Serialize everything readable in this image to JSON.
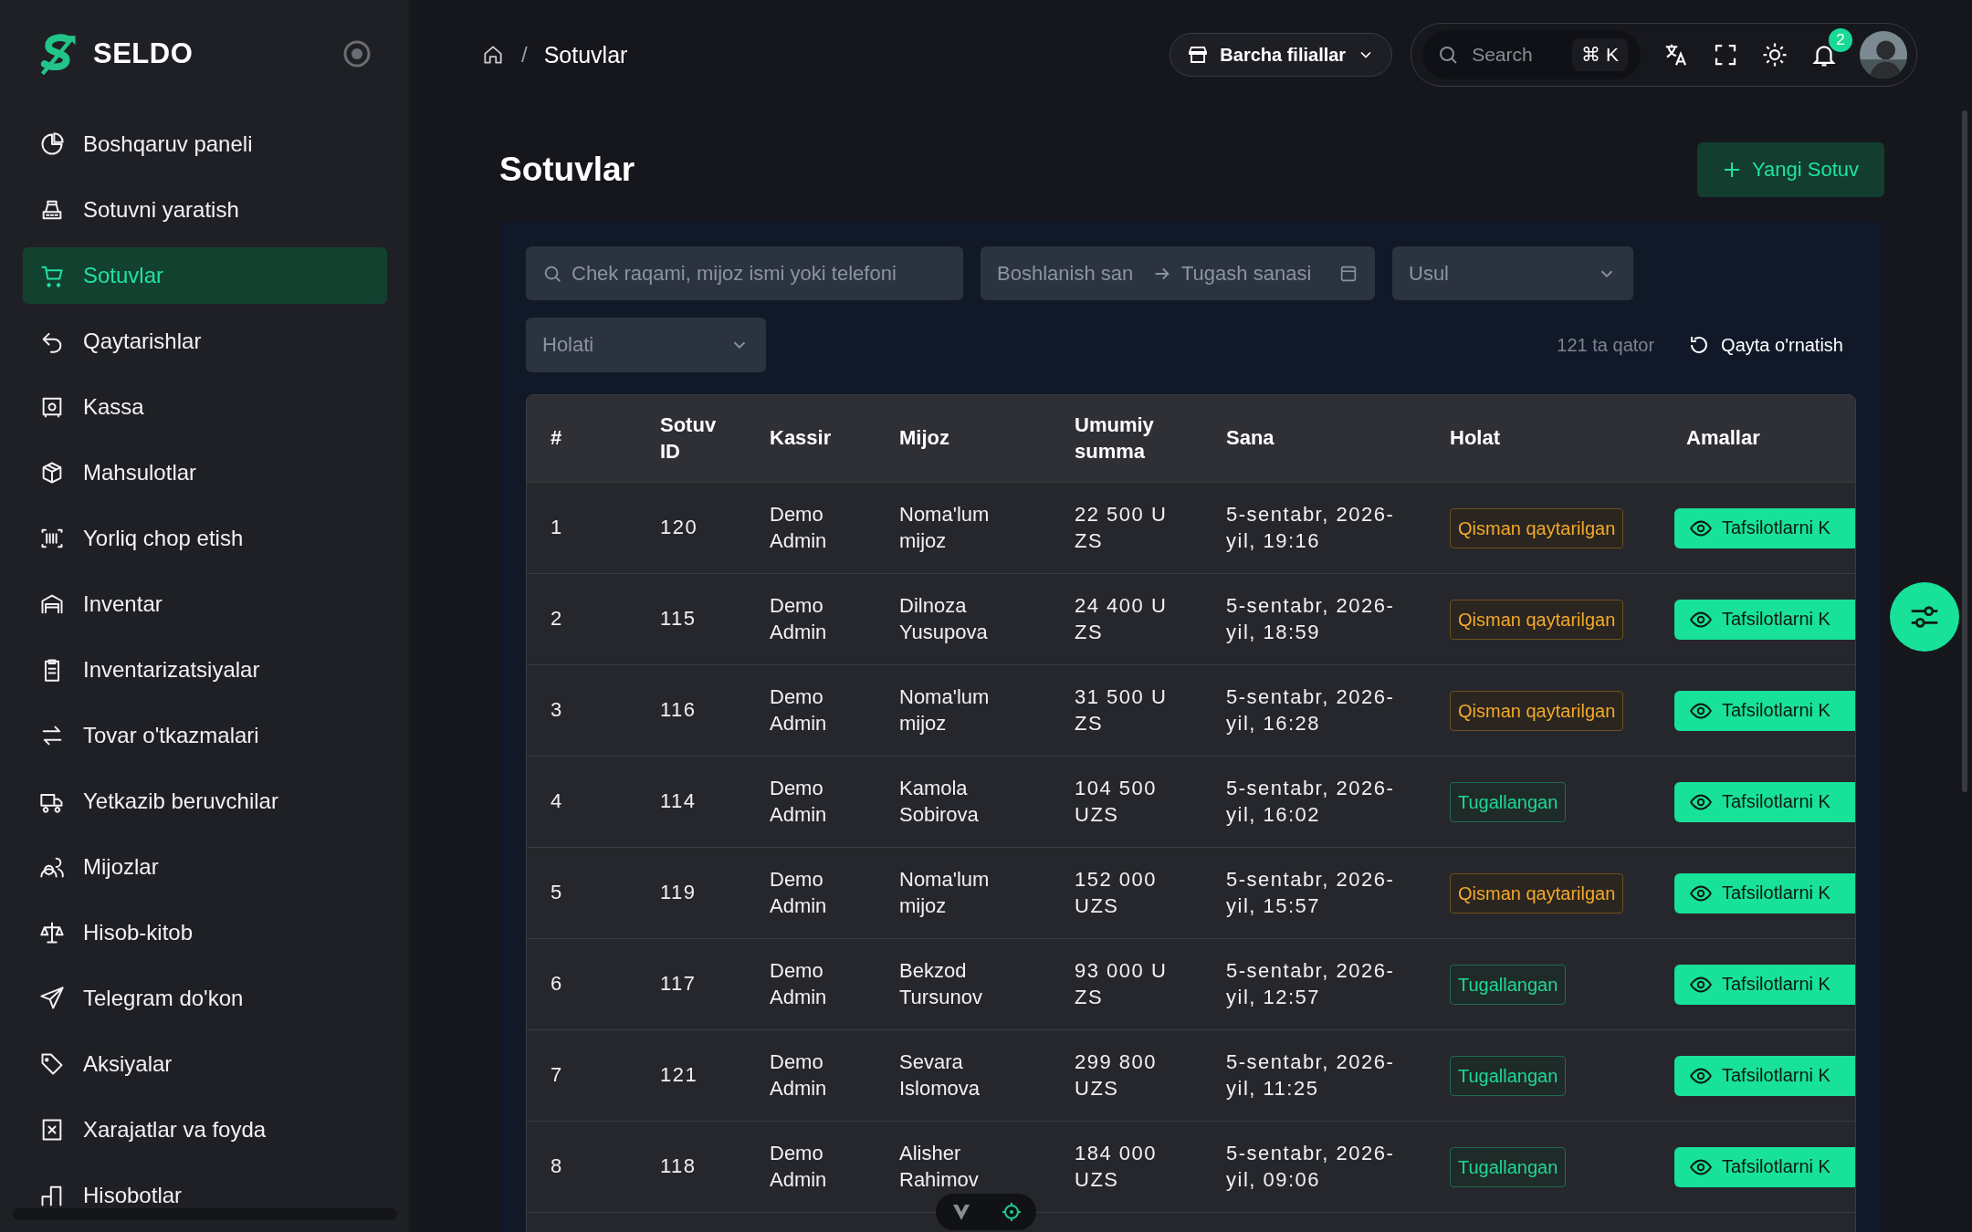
{
  "brand": {
    "name": "SELDO"
  },
  "sidebar": {
    "items": [
      {
        "label": "Boshqaruv paneli",
        "selected": false
      },
      {
        "label": "Sotuvni yaratish",
        "selected": false
      },
      {
        "label": "Sotuvlar",
        "selected": true
      },
      {
        "label": "Qaytarishlar",
        "selected": false
      },
      {
        "label": "Kassa",
        "selected": false
      },
      {
        "label": "Mahsulotlar",
        "selected": false
      },
      {
        "label": "Yorliq chop etish",
        "selected": false
      },
      {
        "label": "Inventar",
        "selected": false
      },
      {
        "label": "Inventarizatsiyalar",
        "selected": false
      },
      {
        "label": "Tovar o'tkazmalari",
        "selected": false
      },
      {
        "label": "Yetkazib beruvchilar",
        "selected": false
      },
      {
        "label": "Mijozlar",
        "selected": false
      },
      {
        "label": "Hisob-kitob",
        "selected": false
      },
      {
        "label": "Telegram do'kon",
        "selected": false
      },
      {
        "label": "Aksiyalar",
        "selected": false
      },
      {
        "label": "Xarajatlar va foyda",
        "selected": false
      },
      {
        "label": "Hisobotlar",
        "selected": false
      }
    ]
  },
  "breadcrumb": {
    "separator": "/",
    "items": [
      "Sotuvlar"
    ]
  },
  "topbar": {
    "branch": "Barcha filiallar",
    "search": {
      "placeholder": "Search",
      "shortcut": "⌘ K"
    },
    "notifications": {
      "count": "2"
    }
  },
  "page": {
    "title": "Sotuvlar",
    "new_button": "Yangi Sotuv"
  },
  "filters": {
    "search": {
      "placeholder": "Chek raqami, mijoz ismi yoki telefoni"
    },
    "date_from": {
      "placeholder": "Boshlanish san"
    },
    "date_to": {
      "placeholder": "Tugash sanasi"
    },
    "method": {
      "placeholder": "Usul"
    },
    "status": {
      "placeholder": "Holati"
    },
    "row_count": "121 ta qator",
    "reset": "Qayta o'rnatish"
  },
  "table": {
    "columns": [
      "#",
      "Sotuv ID",
      "Kassir",
      "Mijoz",
      "Umumiy summa",
      "Sana",
      "Holat",
      "Amallar"
    ],
    "rows": [
      {
        "index": "1",
        "id": "120",
        "cashier": "Demo Admin",
        "customer": "Noma'lum mijoz",
        "total": "22 500 UZS",
        "date": "5-sentabr, 2026-yil, 19:16",
        "status": {
          "label": "Qisman qaytarilgan",
          "kind": "partial"
        },
        "action": "Tafsilotlarni K"
      },
      {
        "index": "2",
        "id": "115",
        "cashier": "Demo Admin",
        "customer": "Dilnoza Yusupova",
        "total": "24 400 UZS",
        "date": "5-sentabr, 2026-yil, 18:59",
        "status": {
          "label": "Qisman qaytarilgan",
          "kind": "partial"
        },
        "action": "Tafsilotlarni K"
      },
      {
        "index": "3",
        "id": "116",
        "cashier": "Demo Admin",
        "customer": "Noma'lum mijoz",
        "total": "31 500 UZS",
        "date": "5-sentabr, 2026-yil, 16:28",
        "status": {
          "label": "Qisman qaytarilgan",
          "kind": "partial"
        },
        "action": "Tafsilotlarni K"
      },
      {
        "index": "4",
        "id": "114",
        "cashier": "Demo Admin",
        "customer": "Kamola Sobirova",
        "total": "104 500 UZS",
        "date": "5-sentabr, 2026-yil, 16:02",
        "status": {
          "label": "Tugallangan",
          "kind": "completed"
        },
        "action": "Tafsilotlarni K"
      },
      {
        "index": "5",
        "id": "119",
        "cashier": "Demo Admin",
        "customer": "Noma'lum mijoz",
        "total": "152 000 UZS",
        "date": "5-sentabr, 2026-yil, 15:57",
        "status": {
          "label": "Qisman qaytarilgan",
          "kind": "partial"
        },
        "action": "Tafsilotlarni K"
      },
      {
        "index": "6",
        "id": "117",
        "cashier": "Demo Admin",
        "customer": "Bekzod Tursunov",
        "total": "93 000 UZS",
        "date": "5-sentabr, 2026-yil, 12:57",
        "status": {
          "label": "Tugallangan",
          "kind": "completed"
        },
        "action": "Tafsilotlarni K"
      },
      {
        "index": "7",
        "id": "121",
        "cashier": "Demo Admin",
        "customer": "Sevara Islomova",
        "total": "299 800 UZS",
        "date": "5-sentabr, 2026-yil, 11:25",
        "status": {
          "label": "Tugallangan",
          "kind": "completed"
        },
        "action": "Tafsilotlarni K"
      },
      {
        "index": "8",
        "id": "118",
        "cashier": "Demo Admin",
        "customer": "Alisher Rahimov",
        "total": "184 000 UZS",
        "date": "5-sentabr, 2026-yil, 09:06",
        "status": {
          "label": "Tugallangan",
          "kind": "completed"
        },
        "action": "Tafsilotlarni K"
      }
    ]
  }
}
